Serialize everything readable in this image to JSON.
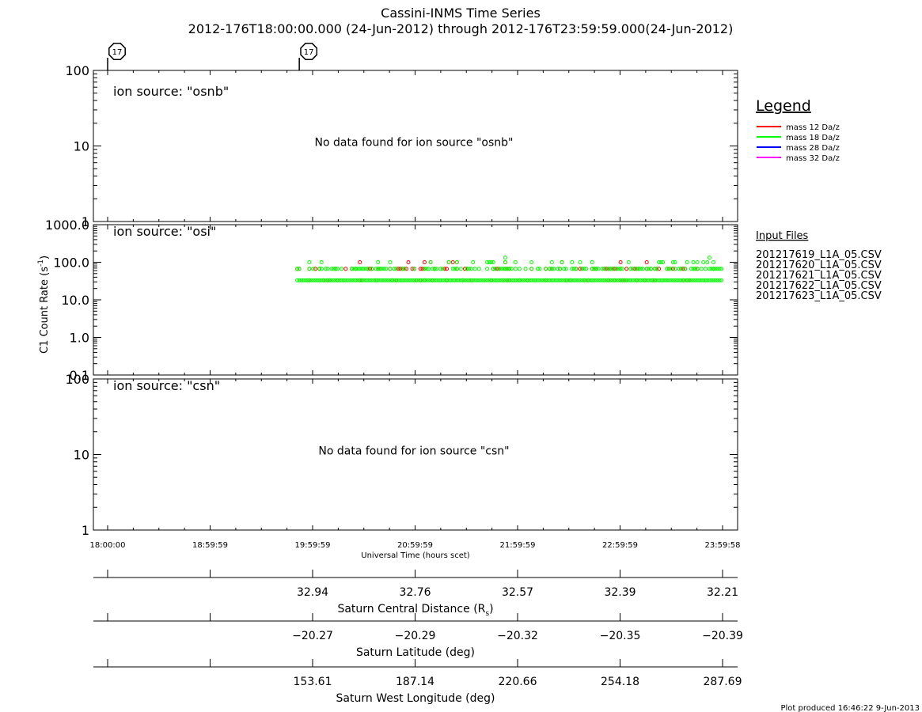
{
  "title": "Cassini-INMS Time Series",
  "subtitle": "2012-176T18:00:00.000 (24-Jun-2012) through 2012-176T23:59:59.000(24-Jun-2012)",
  "markers": [
    {
      "label": "17",
      "x_hours": 0.0
    },
    {
      "label": "17",
      "x_hours": 1.87
    }
  ],
  "legend": {
    "title": "Legend",
    "items": [
      {
        "label": "mass 12 Da/z",
        "color": "#ff0000"
      },
      {
        "label": "mass 18 Da/z",
        "color": "#00ff00"
      },
      {
        "label": "mass 28 Da/z",
        "color": "#0000ff"
      },
      {
        "label": "mass 32 Da/z",
        "color": "#ff00ff"
      }
    ]
  },
  "input_files": {
    "title": "Input Files",
    "items": [
      "201217619_L1A_05.CSV",
      "201217620_L1A_05.CSV",
      "201217621_L1A_05.CSV",
      "201217622_L1A_05.CSV",
      "201217623_L1A_05.CSV"
    ]
  },
  "ylabel": "C1 Count Rate (s",
  "ylabel_sup": "-1",
  "ylabel_end": ")",
  "xlabel": "Universal Time (hours scet)",
  "footer": "Plot produced 16:46:22  9-Jun-2013",
  "chart_data": [
    {
      "type": "scatter",
      "panel": "osnb",
      "label": "ion source: \"osnb\"",
      "no_data": "No data found for ion source \"osnb\"",
      "yscale": "log",
      "ylim": [
        1,
        100
      ],
      "yticks": [
        "1",
        "10",
        "100"
      ],
      "series": []
    },
    {
      "type": "scatter",
      "panel": "osi",
      "label": "ion source: \"osi\"",
      "yscale": "log",
      "ylim": [
        0.1,
        1000
      ],
      "yticks": [
        "0.1",
        "1.0",
        "10.0",
        "100.0",
        "1000.0"
      ],
      "x_range_hours": [
        1.85,
        5.99
      ],
      "series": [
        {
          "name": "mass 12 Da/z",
          "color": "#ff0000",
          "levels": [
            {
              "y": 33,
              "density": 0.25
            },
            {
              "y": 67,
              "density": 0.35
            },
            {
              "y": 100,
              "density": 0.05
            }
          ]
        },
        {
          "name": "mass 18 Da/z",
          "color": "#00ff00",
          "levels": [
            {
              "y": 33,
              "density": 1.0
            },
            {
              "y": 67,
              "density": 0.6
            },
            {
              "y": 100,
              "density": 0.12
            },
            {
              "y": 133,
              "density": 0.01
            }
          ]
        }
      ]
    },
    {
      "type": "scatter",
      "panel": "csn",
      "label": "ion source: \"csn\"",
      "no_data": "No data found for ion source \"csn\"",
      "yscale": "log",
      "ylim": [
        1,
        100
      ],
      "yticks": [
        "1",
        "10",
        "100"
      ],
      "series": []
    }
  ],
  "xaxis": {
    "range_hours": [
      0,
      6
    ],
    "tick_hours": [
      0,
      1,
      2,
      3,
      4,
      5,
      6
    ],
    "tick_labels": [
      "18:00:00",
      "18:59:59",
      "19:59:59",
      "20:59:59",
      "21:59:59",
      "22:59:59",
      "23:59:58"
    ]
  },
  "ephemeris": [
    {
      "label": "Saturn Central Distance (R",
      "sub": "s",
      "label_end": ")",
      "values": [
        "",
        "",
        "32.94",
        "32.76",
        "32.57",
        "32.39",
        "32.21"
      ]
    },
    {
      "label": "Saturn Latitude (deg)",
      "sub": "",
      "label_end": "",
      "values": [
        "",
        "",
        "−20.27",
        "−20.29",
        "−20.32",
        "−20.35",
        "−20.39"
      ]
    },
    {
      "label": "Saturn West Longitude (deg)",
      "sub": "",
      "label_end": "",
      "values": [
        "",
        "",
        "153.61",
        "187.14",
        "220.66",
        "254.18",
        "287.69"
      ]
    }
  ]
}
